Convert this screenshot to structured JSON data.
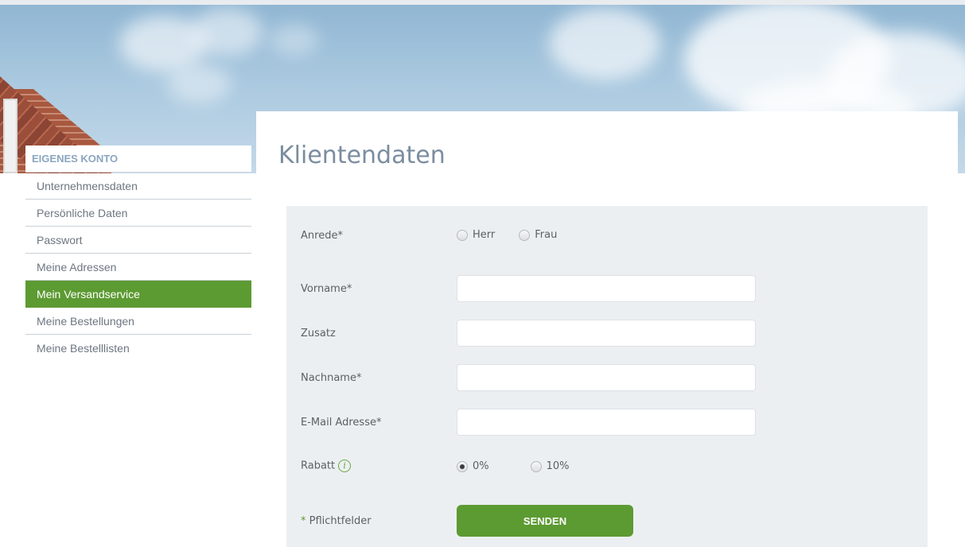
{
  "sidebar": {
    "heading": "EIGENES KONTO",
    "items": [
      {
        "label": "Unternehmensdaten"
      },
      {
        "label": "Persönliche Daten"
      },
      {
        "label": "Passwort"
      },
      {
        "label": "Meine Adressen"
      },
      {
        "label": "Mein Versandservice",
        "active": true
      },
      {
        "label": "Meine Bestellungen"
      },
      {
        "label": "Meine Bestelllisten"
      }
    ]
  },
  "main": {
    "title": "Klientendaten"
  },
  "form": {
    "anrede": {
      "label": "Anrede*",
      "options": [
        {
          "label": "Herr",
          "checked": false
        },
        {
          "label": "Frau",
          "checked": false
        }
      ]
    },
    "vorname": {
      "label": "Vorname*",
      "value": ""
    },
    "zusatz": {
      "label": "Zusatz",
      "value": ""
    },
    "nachname": {
      "label": "Nachname*",
      "value": ""
    },
    "email": {
      "label": "E-Mail Adresse*",
      "value": ""
    },
    "rabatt": {
      "label": "Rabatt",
      "info_icon": "i",
      "options": [
        {
          "label": "0%",
          "checked": true
        },
        {
          "label": "10%",
          "checked": false
        }
      ]
    },
    "required_note": {
      "star": "*",
      "text": " Pflichtfelder"
    },
    "submit_label": "SENDEN"
  },
  "colors": {
    "accent_green": "#5c9a32",
    "title_blue_gray": "#7b8d9f",
    "sidebar_heading": "#8aa6c0",
    "form_panel_bg": "#eceff2"
  }
}
